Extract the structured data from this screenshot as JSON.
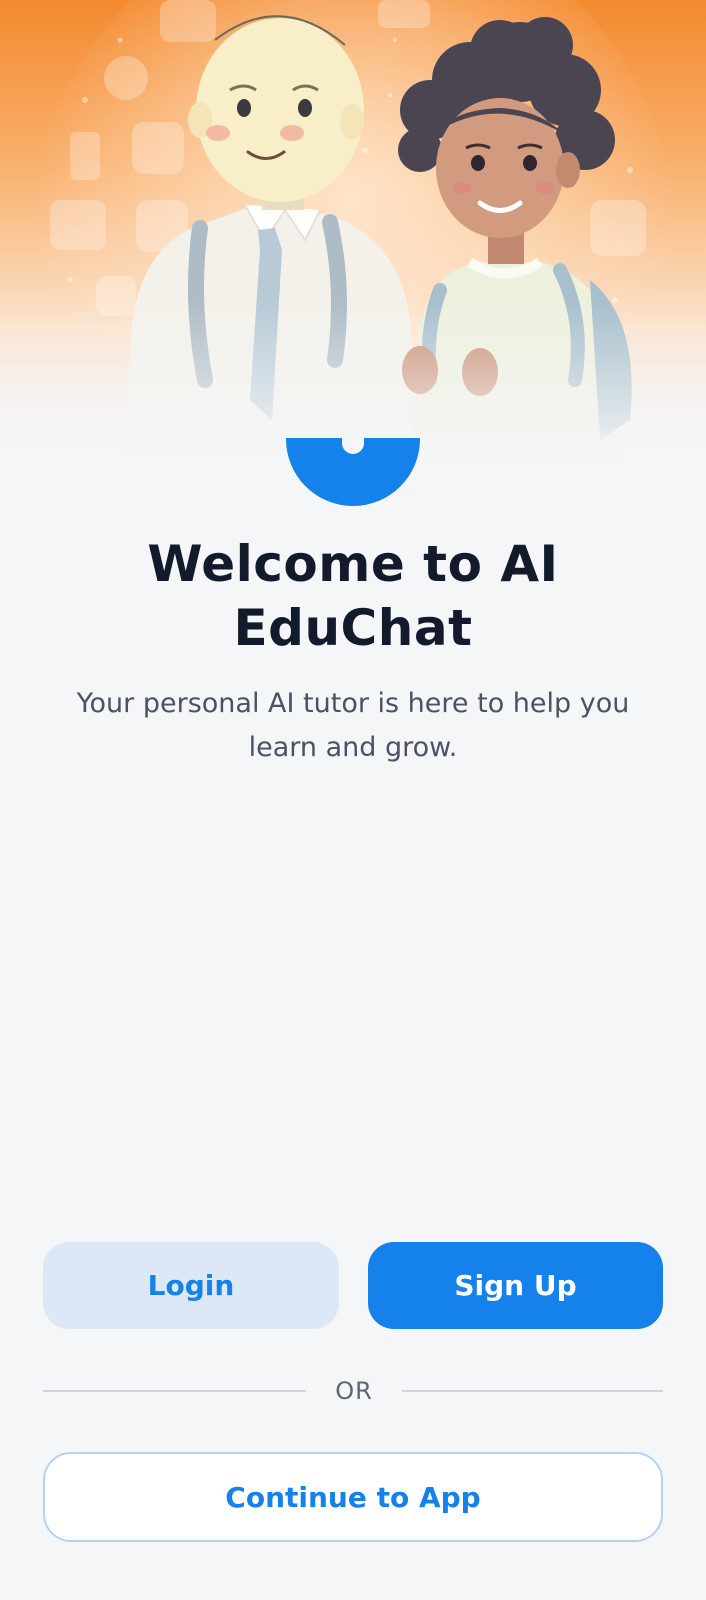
{
  "app": {
    "title_line": "Welcome to AI EduChat",
    "subtitle": "Your personal AI tutor is here to help you learn and grow."
  },
  "hero": {
    "illustration": "two-students-with-backpacks",
    "background_gradient": [
      "#f6923c",
      "#f9c28e",
      "#f5f6f8"
    ]
  },
  "actions": {
    "login_label": "Login",
    "signup_label": "Sign Up",
    "divider_label": "OR",
    "continue_label": "Continue to App"
  },
  "colors": {
    "accent": "#1581ea",
    "login_bg": "#dde8f6",
    "background": "#f5f6f8",
    "title": "#131a2b",
    "subtitle": "#4a5366"
  }
}
